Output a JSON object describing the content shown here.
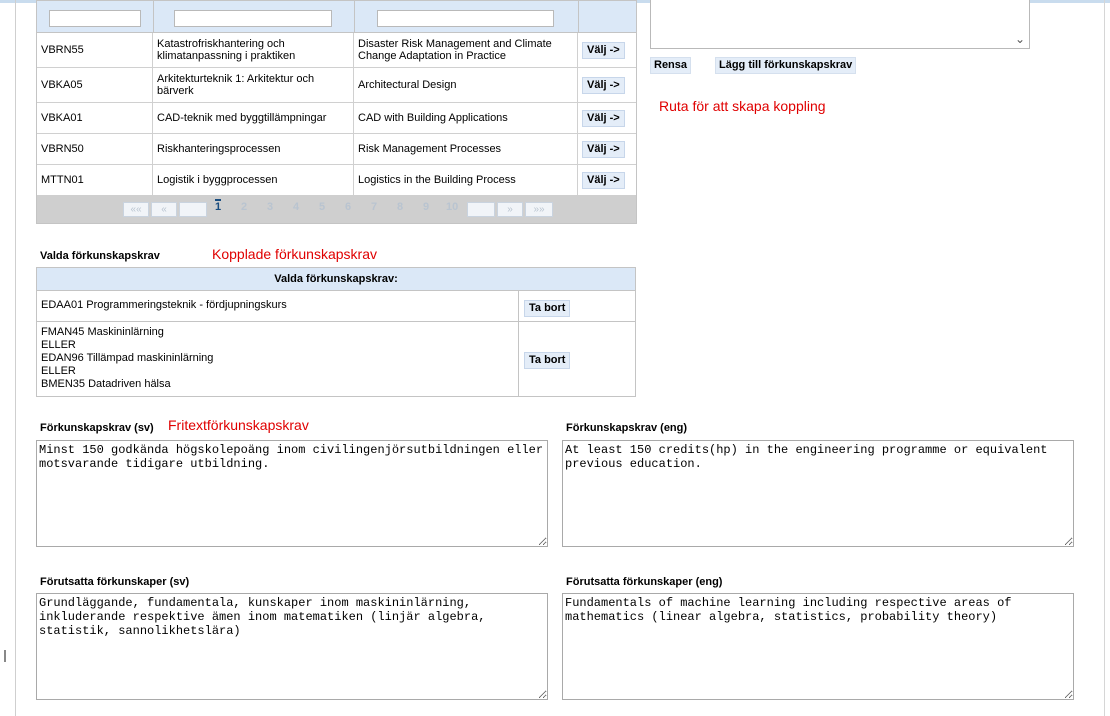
{
  "course_grid": {
    "rows": [
      {
        "code": "VBRN55",
        "name_sv": "Katastrofriskhantering och klimatanpassning i praktiken",
        "name_en": "Disaster Risk Management and Climate Change Adaptation in Practice",
        "action": "Välj ->"
      },
      {
        "code": "VBKA05",
        "name_sv": "Arkitekturteknik 1: Arkitektur och bärverk",
        "name_en": "Architectural Design",
        "action": "Välj ->"
      },
      {
        "code": "VBKA01",
        "name_sv": "CAD-teknik med byggtillämpningar",
        "name_en": "CAD with Building Applications",
        "action": "Välj ->"
      },
      {
        "code": "VBRN50",
        "name_sv": "Riskhanteringsprocessen",
        "name_en": "Risk Management Processes",
        "action": "Välj ->"
      },
      {
        "code": "MTTN01",
        "name_sv": "Logistik i byggprocessen",
        "name_en": "Logistics in the Building Process",
        "action": "Välj ->"
      }
    ],
    "pager": {
      "first": "««",
      "prev": "«",
      "pages": [
        "1",
        "2",
        "3",
        "4",
        "5",
        "6",
        "7",
        "8",
        "9",
        "10"
      ],
      "current": "1",
      "next": "»",
      "last": "»»"
    }
  },
  "right_panel": {
    "clear_button": "Rensa",
    "add_button": "Lägg till förkunskapskrav"
  },
  "annotations": {
    "link_box": "Ruta för att skapa koppling",
    "linked": "Kopplade förkunskapskrav",
    "freetext": "Fritextförkunskapskrav"
  },
  "selected": {
    "section_label": "Valda förkunskapskrav",
    "table_header": "Valda förkunskapskrav:",
    "rows": [
      {
        "lines": [
          "EDAA01 Programmeringsteknik - fördjupningskurs"
        ],
        "button": "Ta bort"
      },
      {
        "lines": [
          "FMAN45 Maskininlärning",
          "ELLER",
          "EDAN96 Tillämpad maskininlärning",
          "ELLER",
          "BMEN35 Datadriven hälsa"
        ],
        "button": "Ta bort"
      }
    ]
  },
  "prereq": {
    "sv_label": "Förkunskapskrav (sv)",
    "en_label": "Förkunskapskrav (eng)",
    "sv_text": "Minst 150 godkända högskolepoäng inom civilingenjörsutbildningen eller motsvarande tidigare utbildning.",
    "en_text": "At least 150 credits(hp) in the engineering programme or equivalent previous education."
  },
  "assumed": {
    "sv_label": "Förutsatta förkunskaper (sv)",
    "en_label": "Förutsatta förkunskaper (eng)",
    "sv_text": "Grundläggande, fundamentala, kunskaper inom maskininlärning, inkluderande respektive ämen inom matematiken (linjär algebra, statistik, sannolikhetslära)",
    "en_text": "Fundamentals of machine learning including respective areas of mathematics (linear algebra, statistics, probability theory)"
  },
  "colors": {
    "annotation": "#e00000",
    "header_bg": "#dbe8f7",
    "button_bg": "#e4edf8",
    "pager_bg": "#cfcfcf"
  }
}
